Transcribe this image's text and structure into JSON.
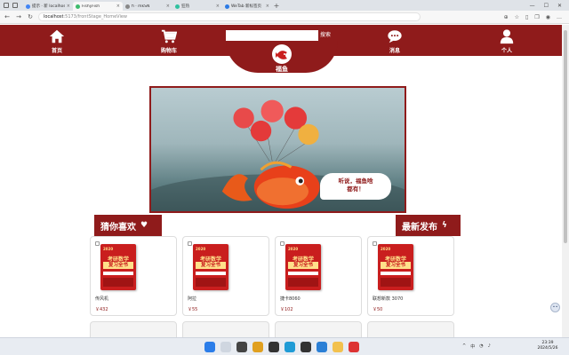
{
  "browser": {
    "tabs": [
      {
        "title": "提示 · 新 localhost · 代码之路",
        "color": "#4285f4",
        "active": false
      },
      {
        "title": "FishyFish",
        "color": "#3dbb6d",
        "active": true
      },
      {
        "title": "fi · mkSN",
        "color": "#888888",
        "active": false
      },
      {
        "title": "狂热",
        "color": "#30c19f",
        "active": false
      },
      {
        "title": "WeTab 新标签页",
        "color": "#2c7be5",
        "active": false
      }
    ],
    "url_host": "localhost",
    "url_path": ":5173/frontStage_HomeView"
  },
  "nav": {
    "home": "首页",
    "cart": "购物车",
    "search_placeholder": "",
    "search_button": "搜索",
    "logo_text": "福鱼",
    "messages": "消息",
    "profile": "个人"
  },
  "banner": {
    "bubble_line1": "听说，福鱼啥",
    "bubble_line2": "都有！"
  },
  "sections": {
    "guess": "猜你喜欢",
    "latest": "最新发布"
  },
  "book_cover": {
    "year": "2020",
    "title1": "考研数学",
    "title2": "复习全书"
  },
  "products": [
    {
      "name": "传风机",
      "price": "￥432"
    },
    {
      "name": "阿拉",
      "price": "￥55"
    },
    {
      "name": "捷卡8060",
      "price": "￥102"
    },
    {
      "name": "联想新款 3070",
      "price": "￥50"
    }
  ],
  "chat_icon": "chat-bubble-icon",
  "taskbar": {
    "time": "23:39",
    "date": "2024/5/26",
    "lang": "中"
  },
  "colors": {
    "brand": "#8f1b1b",
    "book_red": "#c91e1e",
    "book_gold": "#ffe08a"
  }
}
